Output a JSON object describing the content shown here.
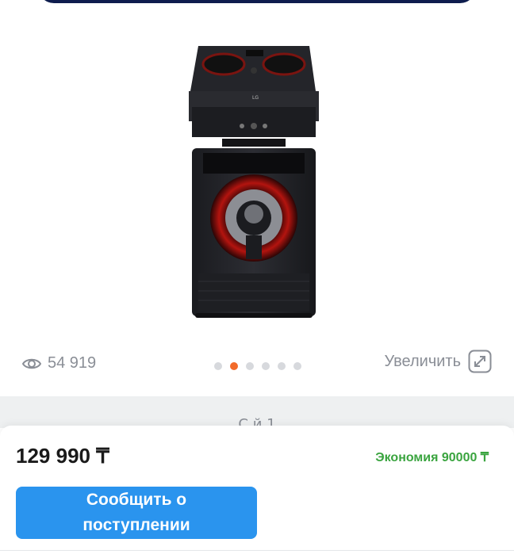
{
  "gallery": {
    "image_alt": "LG speaker",
    "views_icon": "eye-icon",
    "views_count": "54 919",
    "dots_total": 6,
    "active_dot": 2,
    "zoom_label": "Увеличить",
    "zoom_icon": "expand-icon"
  },
  "strip": {
    "partial_text": "С                 й      1"
  },
  "purchase": {
    "price": "129 990 ₸",
    "savings": "Экономия 90000 ₸",
    "notify_button_line1": "Сообщить о",
    "notify_button_line2": "поступлении"
  },
  "colors": {
    "accent_blue": "#2a94ee",
    "dot_active": "#f26b2a",
    "savings_green": "#3aa43f",
    "top_bar": "#0e1d4e"
  }
}
